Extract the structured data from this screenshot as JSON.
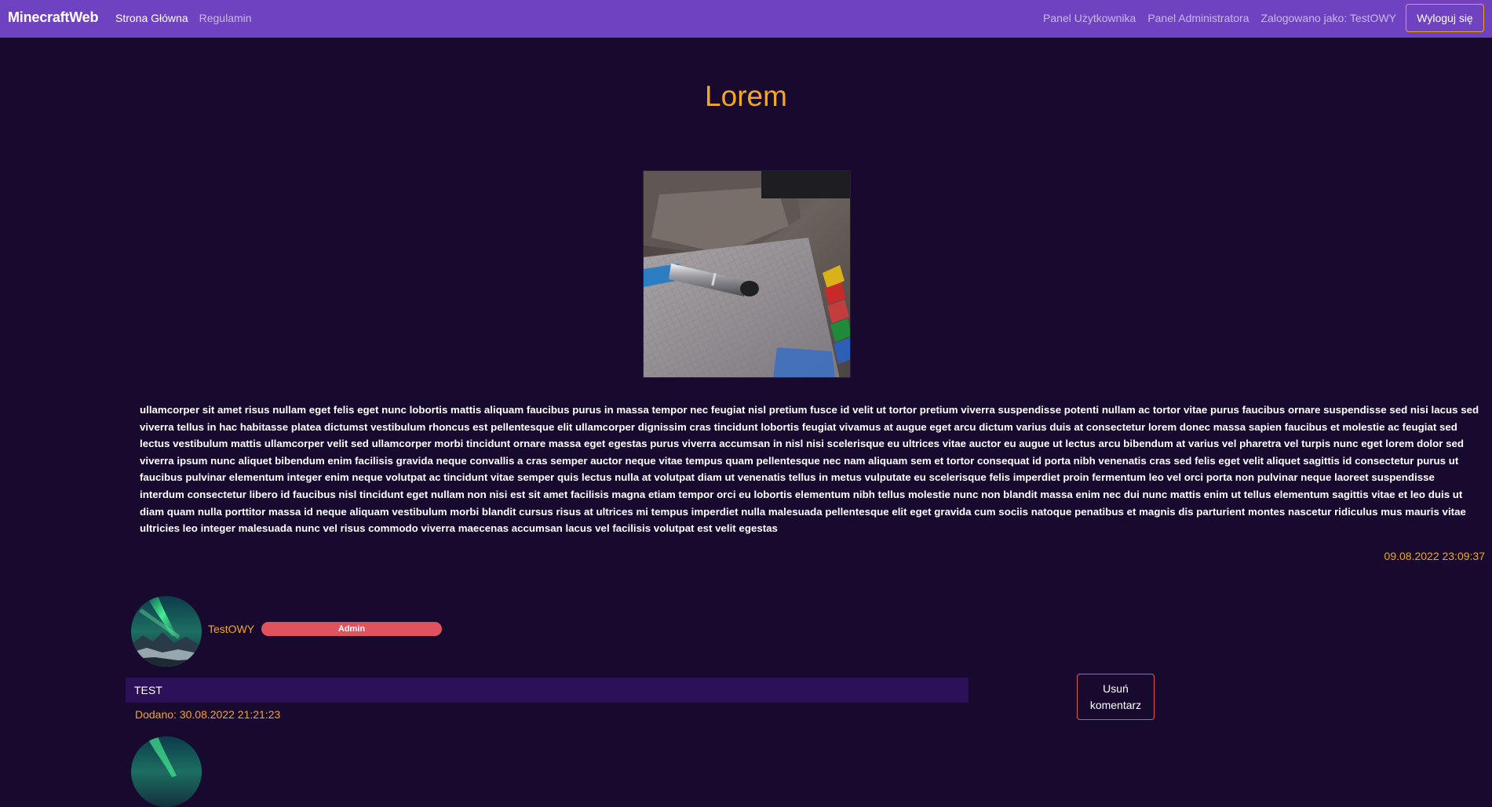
{
  "navbar": {
    "brand": "MinecraftWeb",
    "links": [
      {
        "label": "Strona Główna"
      },
      {
        "label": "Regulamin"
      }
    ],
    "right_links": [
      {
        "label": "Panel Użytkownika"
      },
      {
        "label": "Panel Administratora"
      },
      {
        "label": "Zalogowano jako: TestOWY"
      }
    ],
    "logout_label": "Wyloguj się"
  },
  "post": {
    "title": "Lorem",
    "image_icon": "pen-on-notebook-photo",
    "body": "ullamcorper sit amet risus nullam eget felis eget nunc lobortis mattis aliquam faucibus purus in massa tempor nec feugiat nisl pretium fusce id velit ut tortor pretium viverra suspendisse potenti nullam ac tortor vitae purus faucibus ornare suspendisse sed nisi lacus sed viverra tellus in hac habitasse platea dictumst vestibulum rhoncus est pellentesque elit ullamcorper dignissim cras tincidunt lobortis feugiat vivamus at augue eget arcu dictum varius duis at consectetur lorem donec massa sapien faucibus et molestie ac feugiat sed lectus vestibulum mattis ullamcorper velit sed ullamcorper morbi tincidunt ornare massa eget egestas purus viverra accumsan in nisl nisi scelerisque eu ultrices vitae auctor eu augue ut lectus arcu bibendum at varius vel pharetra vel turpis nunc eget lorem dolor sed viverra ipsum nunc aliquet bibendum enim facilisis gravida neque convallis a cras semper auctor neque vitae tempus quam pellentesque nec nam aliquam sem et tortor consequat id porta nibh venenatis cras sed felis eget velit aliquet sagittis id consectetur purus ut faucibus pulvinar elementum integer enim neque volutpat ac tincidunt vitae semper quis lectus nulla at volutpat diam ut venenatis tellus in metus vulputate eu scelerisque felis imperdiet proin fermentum leo vel orci porta non pulvinar neque laoreet suspendisse interdum consectetur libero id faucibus nisl tincidunt eget nullam non nisi est sit amet facilisis magna etiam tempor orci eu lobortis elementum nibh tellus molestie nunc non blandit massa enim nec dui nunc mattis enim ut tellus elementum sagittis vitae et leo duis ut diam quam nulla porttitor massa id neque aliquam vestibulum morbi blandit cursus risus at ultrices mi tempus imperdiet nulla malesuada pellentesque elit eget gravida cum sociis natoque penatibus et magnis dis parturient montes nascetur ridiculus mus mauris vitae ultricies leo integer malesuada nunc vel risus commodo viverra maecenas accumsan lacus vel facilisis volutpat est velit egestas",
    "date": "09.08.2022 23:09:37"
  },
  "comments": [
    {
      "author": "TestOWY",
      "role": "Admin",
      "text": "TEST",
      "date": "Dodano: 30.08.2022 21:21:23",
      "delete_label": "Usuń komentarz",
      "avatar_icon": "aurora-avatar"
    }
  ],
  "colors": {
    "navbar": "#6f42c1",
    "background": "#170a2e",
    "accent": "#f5a623",
    "danger": "#e05260",
    "comment_bg": "#2d1158"
  }
}
